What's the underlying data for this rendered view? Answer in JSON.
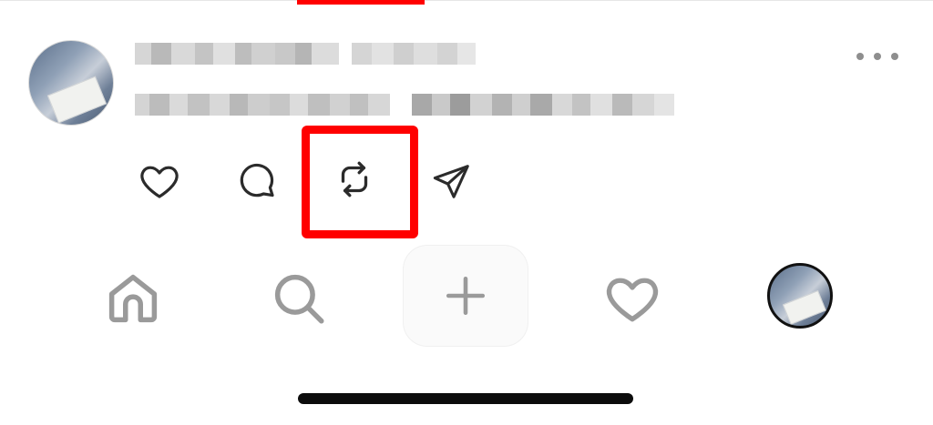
{
  "post": {
    "author_name": "",
    "caption": "",
    "more_icon": "more-horizontal-icon",
    "actions": {
      "like_icon": "heart-outline-icon",
      "comment_icon": "comment-bubble-icon",
      "repost_icon": "repost-arrows-icon",
      "share_icon": "send-paper-plane-icon"
    }
  },
  "bottom_nav": {
    "home_icon": "home-icon",
    "search_icon": "search-icon",
    "create_icon": "plus-icon",
    "activity_icon": "heart-outline-icon",
    "profile_icon": "avatar"
  },
  "colors": {
    "highlight": "#ff0000",
    "icon_dark": "#2b2b2b",
    "icon_nav": "#9a9a9a",
    "home_indicator": "#0c0c0c"
  }
}
